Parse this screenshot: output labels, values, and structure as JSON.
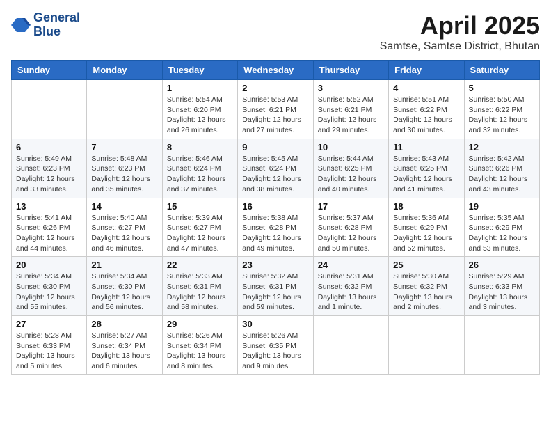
{
  "header": {
    "logo_line1": "General",
    "logo_line2": "Blue",
    "title": "April 2025",
    "subtitle": "Samtse, Samtse District, Bhutan"
  },
  "calendar": {
    "days_of_week": [
      "Sunday",
      "Monday",
      "Tuesday",
      "Wednesday",
      "Thursday",
      "Friday",
      "Saturday"
    ],
    "weeks": [
      [
        {
          "day": null
        },
        {
          "day": null
        },
        {
          "day": "1",
          "detail": "Sunrise: 5:54 AM\nSunset: 6:20 PM\nDaylight: 12 hours\nand 26 minutes."
        },
        {
          "day": "2",
          "detail": "Sunrise: 5:53 AM\nSunset: 6:21 PM\nDaylight: 12 hours\nand 27 minutes."
        },
        {
          "day": "3",
          "detail": "Sunrise: 5:52 AM\nSunset: 6:21 PM\nDaylight: 12 hours\nand 29 minutes."
        },
        {
          "day": "4",
          "detail": "Sunrise: 5:51 AM\nSunset: 6:22 PM\nDaylight: 12 hours\nand 30 minutes."
        },
        {
          "day": "5",
          "detail": "Sunrise: 5:50 AM\nSunset: 6:22 PM\nDaylight: 12 hours\nand 32 minutes."
        }
      ],
      [
        {
          "day": "6",
          "detail": "Sunrise: 5:49 AM\nSunset: 6:23 PM\nDaylight: 12 hours\nand 33 minutes."
        },
        {
          "day": "7",
          "detail": "Sunrise: 5:48 AM\nSunset: 6:23 PM\nDaylight: 12 hours\nand 35 minutes."
        },
        {
          "day": "8",
          "detail": "Sunrise: 5:46 AM\nSunset: 6:24 PM\nDaylight: 12 hours\nand 37 minutes."
        },
        {
          "day": "9",
          "detail": "Sunrise: 5:45 AM\nSunset: 6:24 PM\nDaylight: 12 hours\nand 38 minutes."
        },
        {
          "day": "10",
          "detail": "Sunrise: 5:44 AM\nSunset: 6:25 PM\nDaylight: 12 hours\nand 40 minutes."
        },
        {
          "day": "11",
          "detail": "Sunrise: 5:43 AM\nSunset: 6:25 PM\nDaylight: 12 hours\nand 41 minutes."
        },
        {
          "day": "12",
          "detail": "Sunrise: 5:42 AM\nSunset: 6:26 PM\nDaylight: 12 hours\nand 43 minutes."
        }
      ],
      [
        {
          "day": "13",
          "detail": "Sunrise: 5:41 AM\nSunset: 6:26 PM\nDaylight: 12 hours\nand 44 minutes."
        },
        {
          "day": "14",
          "detail": "Sunrise: 5:40 AM\nSunset: 6:27 PM\nDaylight: 12 hours\nand 46 minutes."
        },
        {
          "day": "15",
          "detail": "Sunrise: 5:39 AM\nSunset: 6:27 PM\nDaylight: 12 hours\nand 47 minutes."
        },
        {
          "day": "16",
          "detail": "Sunrise: 5:38 AM\nSunset: 6:28 PM\nDaylight: 12 hours\nand 49 minutes."
        },
        {
          "day": "17",
          "detail": "Sunrise: 5:37 AM\nSunset: 6:28 PM\nDaylight: 12 hours\nand 50 minutes."
        },
        {
          "day": "18",
          "detail": "Sunrise: 5:36 AM\nSunset: 6:29 PM\nDaylight: 12 hours\nand 52 minutes."
        },
        {
          "day": "19",
          "detail": "Sunrise: 5:35 AM\nSunset: 6:29 PM\nDaylight: 12 hours\nand 53 minutes."
        }
      ],
      [
        {
          "day": "20",
          "detail": "Sunrise: 5:34 AM\nSunset: 6:30 PM\nDaylight: 12 hours\nand 55 minutes."
        },
        {
          "day": "21",
          "detail": "Sunrise: 5:34 AM\nSunset: 6:30 PM\nDaylight: 12 hours\nand 56 minutes."
        },
        {
          "day": "22",
          "detail": "Sunrise: 5:33 AM\nSunset: 6:31 PM\nDaylight: 12 hours\nand 58 minutes."
        },
        {
          "day": "23",
          "detail": "Sunrise: 5:32 AM\nSunset: 6:31 PM\nDaylight: 12 hours\nand 59 minutes."
        },
        {
          "day": "24",
          "detail": "Sunrise: 5:31 AM\nSunset: 6:32 PM\nDaylight: 13 hours\nand 1 minute."
        },
        {
          "day": "25",
          "detail": "Sunrise: 5:30 AM\nSunset: 6:32 PM\nDaylight: 13 hours\nand 2 minutes."
        },
        {
          "day": "26",
          "detail": "Sunrise: 5:29 AM\nSunset: 6:33 PM\nDaylight: 13 hours\nand 3 minutes."
        }
      ],
      [
        {
          "day": "27",
          "detail": "Sunrise: 5:28 AM\nSunset: 6:33 PM\nDaylight: 13 hours\nand 5 minutes."
        },
        {
          "day": "28",
          "detail": "Sunrise: 5:27 AM\nSunset: 6:34 PM\nDaylight: 13 hours\nand 6 minutes."
        },
        {
          "day": "29",
          "detail": "Sunrise: 5:26 AM\nSunset: 6:34 PM\nDaylight: 13 hours\nand 8 minutes."
        },
        {
          "day": "30",
          "detail": "Sunrise: 5:26 AM\nSunset: 6:35 PM\nDaylight: 13 hours\nand 9 minutes."
        },
        {
          "day": null
        },
        {
          "day": null
        },
        {
          "day": null
        }
      ]
    ]
  }
}
